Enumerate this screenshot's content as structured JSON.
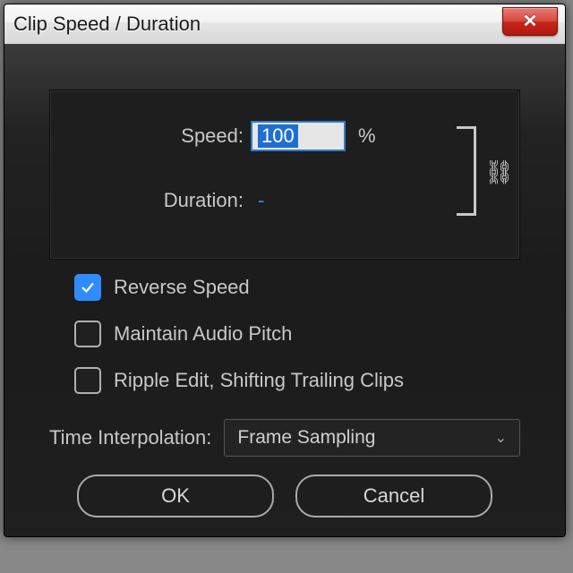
{
  "window": {
    "title": "Clip Speed / Duration"
  },
  "panel": {
    "speed_label": "Speed:",
    "speed_value": "100",
    "speed_unit": "%",
    "duration_label": "Duration:",
    "duration_value": "-"
  },
  "checkboxes": {
    "reverse": {
      "label": "Reverse Speed",
      "checked": true
    },
    "pitch": {
      "label": "Maintain Audio Pitch",
      "checked": false
    },
    "ripple": {
      "label": "Ripple Edit, Shifting Trailing Clips",
      "checked": false
    }
  },
  "time_interpolation": {
    "label": "Time Interpolation:",
    "selected": "Frame Sampling"
  },
  "buttons": {
    "ok": "OK",
    "cancel": "Cancel"
  }
}
